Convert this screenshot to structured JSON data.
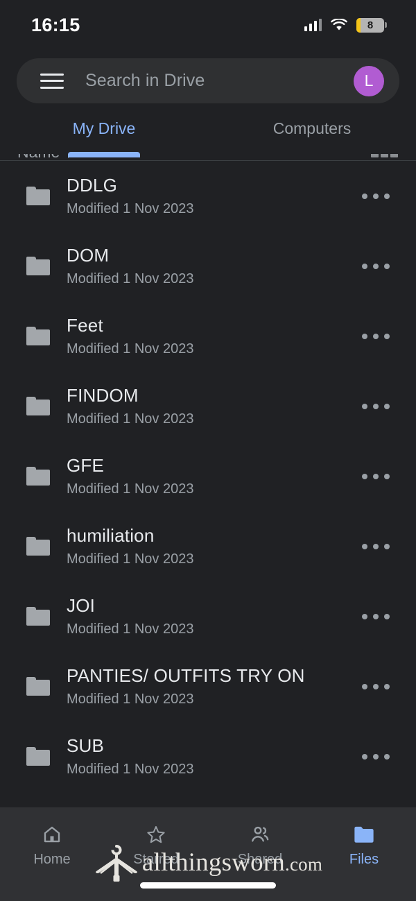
{
  "status_bar": {
    "time": "16:15",
    "signal_icon": "cellular-signal-icon",
    "wifi_icon": "wifi-icon",
    "battery_icon": "battery-icon",
    "battery_level": "8"
  },
  "search": {
    "menu_icon": "hamburger-menu-icon",
    "placeholder": "Search in Drive",
    "value": "",
    "avatar_initial": "L",
    "avatar_color": "#b15cd2"
  },
  "tabs": [
    {
      "label": "My Drive",
      "active": true
    },
    {
      "label": "Computers",
      "active": false
    }
  ],
  "list_header": {
    "sort_label": "Name ↑",
    "view_toggle_icon": "grid-view-icon"
  },
  "files": [
    {
      "name": "DDLG",
      "modified": "Modified 1 Nov 2023",
      "icon": "folder-icon"
    },
    {
      "name": "DOM",
      "modified": "Modified 1 Nov 2023",
      "icon": "folder-icon"
    },
    {
      "name": "Feet",
      "modified": "Modified 1 Nov 2023",
      "icon": "folder-icon"
    },
    {
      "name": "FINDOM",
      "modified": "Modified 1 Nov 2023",
      "icon": "folder-icon"
    },
    {
      "name": "GFE",
      "modified": "Modified 1 Nov 2023",
      "icon": "folder-icon"
    },
    {
      "name": "humiliation",
      "modified": "Modified 1 Nov 2023",
      "icon": "folder-icon"
    },
    {
      "name": "JOI",
      "modified": "Modified 1 Nov 2023",
      "icon": "folder-icon"
    },
    {
      "name": "PANTIES/ OUTFITS TRY ON",
      "modified": "Modified 1 Nov 2023",
      "icon": "folder-icon"
    },
    {
      "name": "SUB",
      "modified": "Modified 1 Nov 2023",
      "icon": "folder-icon"
    }
  ],
  "row_menu_icon": "overflow-menu-icon",
  "bottom_nav": [
    {
      "label": "Home",
      "icon": "home-icon",
      "active": false
    },
    {
      "label": "Starred",
      "icon": "star-icon",
      "active": false
    },
    {
      "label": "Shared",
      "icon": "people-icon",
      "active": false
    },
    {
      "label": "Files",
      "icon": "folder-filled-icon",
      "active": true
    }
  ],
  "watermark": {
    "logo_icon": "clothes-hanger-icon",
    "brand": "allthingsworn",
    "tld": ".com"
  },
  "colors": {
    "background": "#202124",
    "surface": "#2f3032",
    "nav_background": "#303134",
    "accent": "#8ab4f8",
    "text_primary": "#e8eaed",
    "text_secondary": "#9aa0a6",
    "folder_gray": "#a3a7ab",
    "battery_warning": "#f5c518"
  }
}
